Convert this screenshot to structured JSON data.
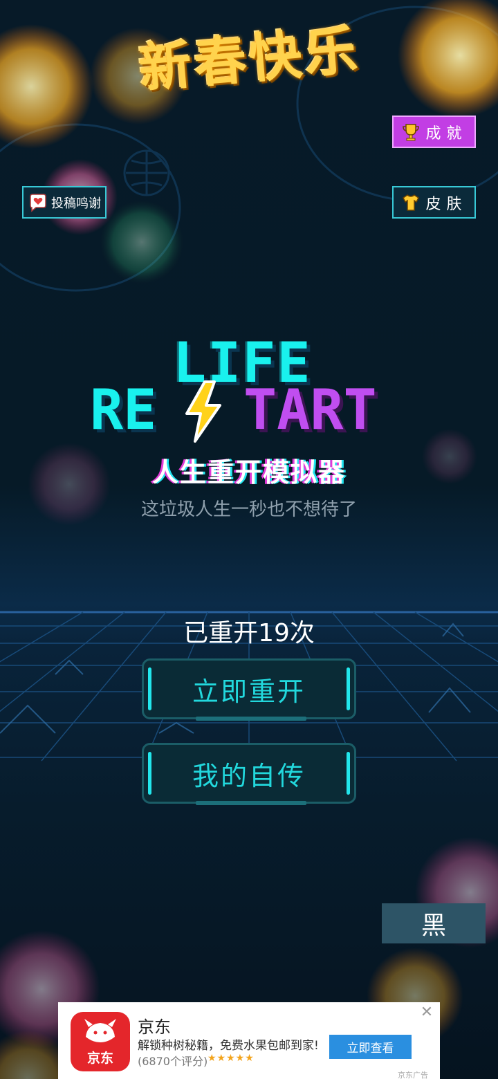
{
  "header": {
    "greeting": "新春快乐"
  },
  "buttons": {
    "achievements": "成就",
    "skins": "皮肤",
    "contributors": "投稿鸣谢"
  },
  "logo": {
    "line1": "LIFE",
    "line2_left": "RE",
    "line2_right": "TART"
  },
  "title": {
    "subtitle": "人生重开模拟器",
    "tagline": "这垃圾人生一秒也不想待了"
  },
  "stats": {
    "restart_count_text": "已重开19次"
  },
  "main": {
    "restart_label": "立即重开",
    "biography_label": "我的自传"
  },
  "theme_toggle": {
    "label": "黑"
  },
  "ad": {
    "app_name": "京东",
    "logo_text": "京东",
    "description": "解锁种树秘籍，免费水果包邮到家!",
    "rating_text": "(6870个评分)",
    "stars": "★★★★★",
    "cta": "立即查看",
    "close": "✕",
    "ad_label": "京东广告"
  },
  "colors": {
    "cyan": "#19f1ee",
    "magenta": "#c04ef0",
    "achievement_bg": "#c23ee4",
    "button_border": "#38c9d6",
    "ad_cta": "#2a8fe0",
    "jd_red": "#e4262b"
  }
}
